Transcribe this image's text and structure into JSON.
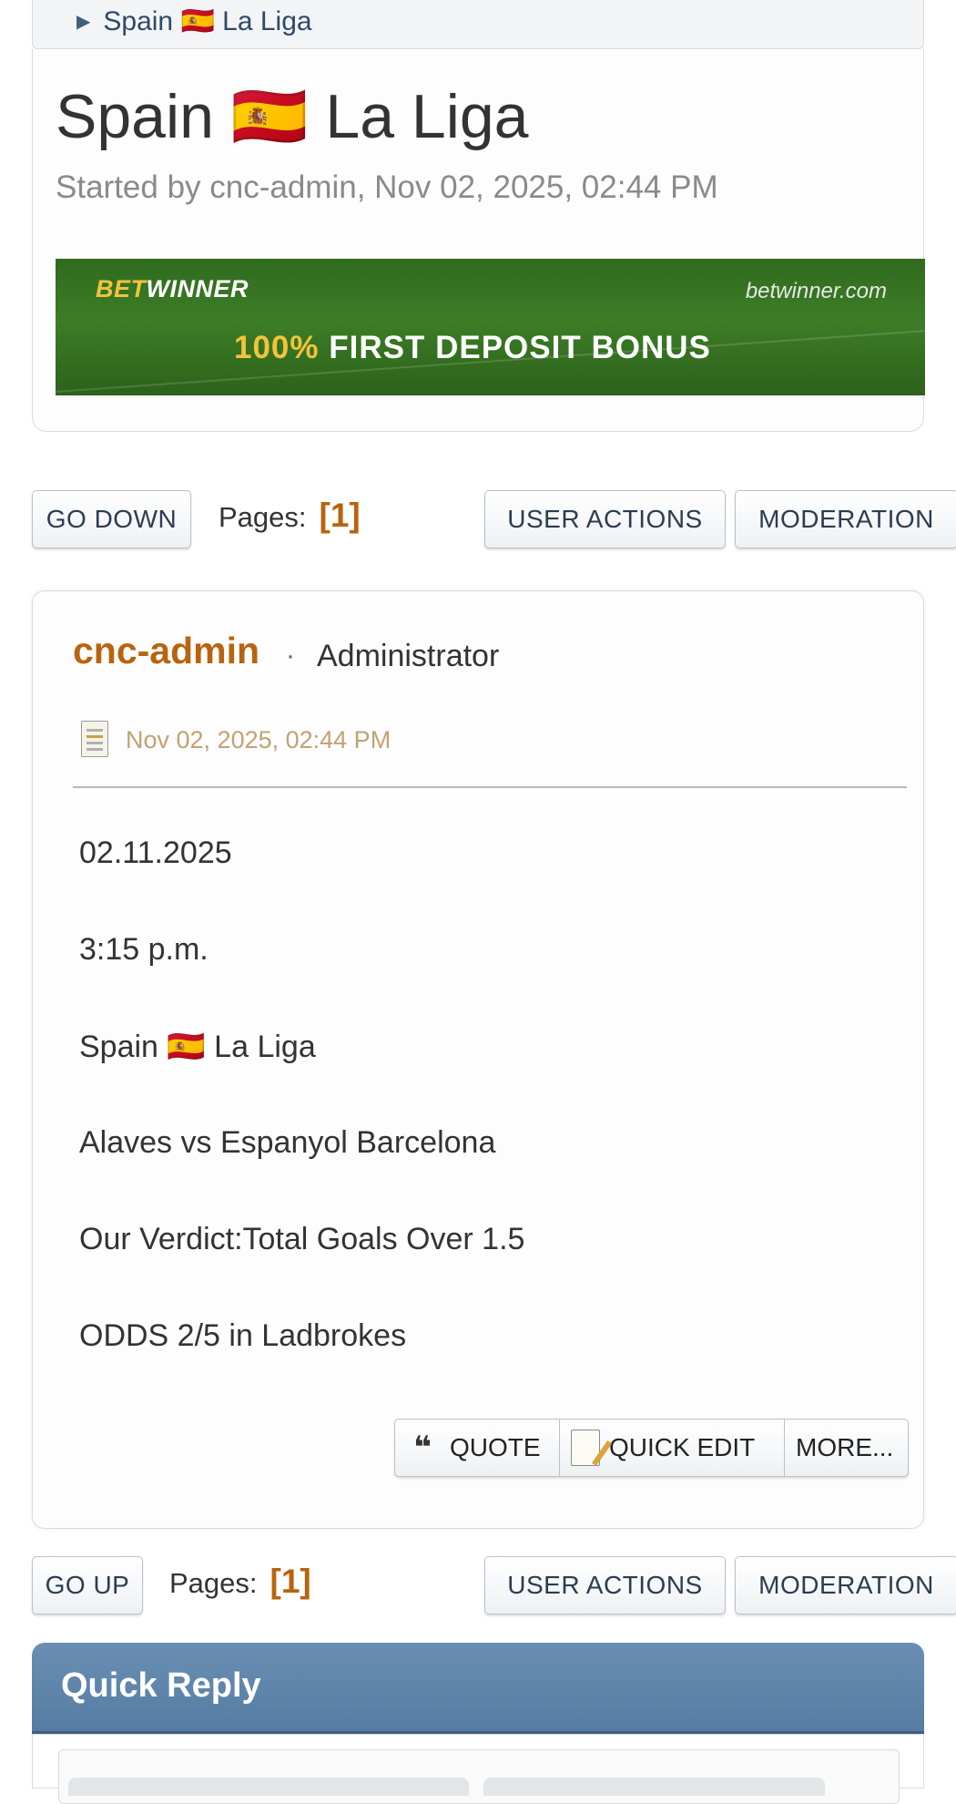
{
  "breadcrumb": {
    "current": "Spain 🇪🇸 La Liga"
  },
  "topic": {
    "title": "Spain 🇪🇸 La Liga",
    "meta": "Started by cnc-admin, Nov 02, 2025, 02:44 PM"
  },
  "banner": {
    "brand_part1": "BET",
    "brand_part2": "WINNER",
    "domain": "betwinner.com",
    "bonus_pct": "100%",
    "bonus_text": " FIRST DEPOSIT BONUS"
  },
  "nav_top": {
    "go_button": "GO DOWN",
    "pages_label": "Pages:",
    "current_page": "[1]",
    "user_actions": "USER ACTIONS",
    "moderation": "MODERATION"
  },
  "post": {
    "author": "cnc-admin",
    "separator": "·",
    "rank": "Administrator",
    "date": "Nov 02, 2025, 02:44 PM",
    "lines": [
      "02.11.2025",
      "3:15 p.m.",
      "Spain 🇪🇸 La Liga",
      "Alaves vs Espanyol Barcelona",
      "Our Verdict:Total Goals Over 1.5",
      "ODDS 2/5 in Ladbrokes"
    ],
    "actions": {
      "quote": "QUOTE",
      "quick_edit": "QUICK EDIT",
      "more": "MORE..."
    }
  },
  "nav_bottom": {
    "go_button": "GO UP",
    "pages_label": "Pages:",
    "current_page": "[1]",
    "user_actions": "USER ACTIONS",
    "moderation": "MODERATION"
  },
  "quick_reply": {
    "title": "Quick Reply"
  }
}
